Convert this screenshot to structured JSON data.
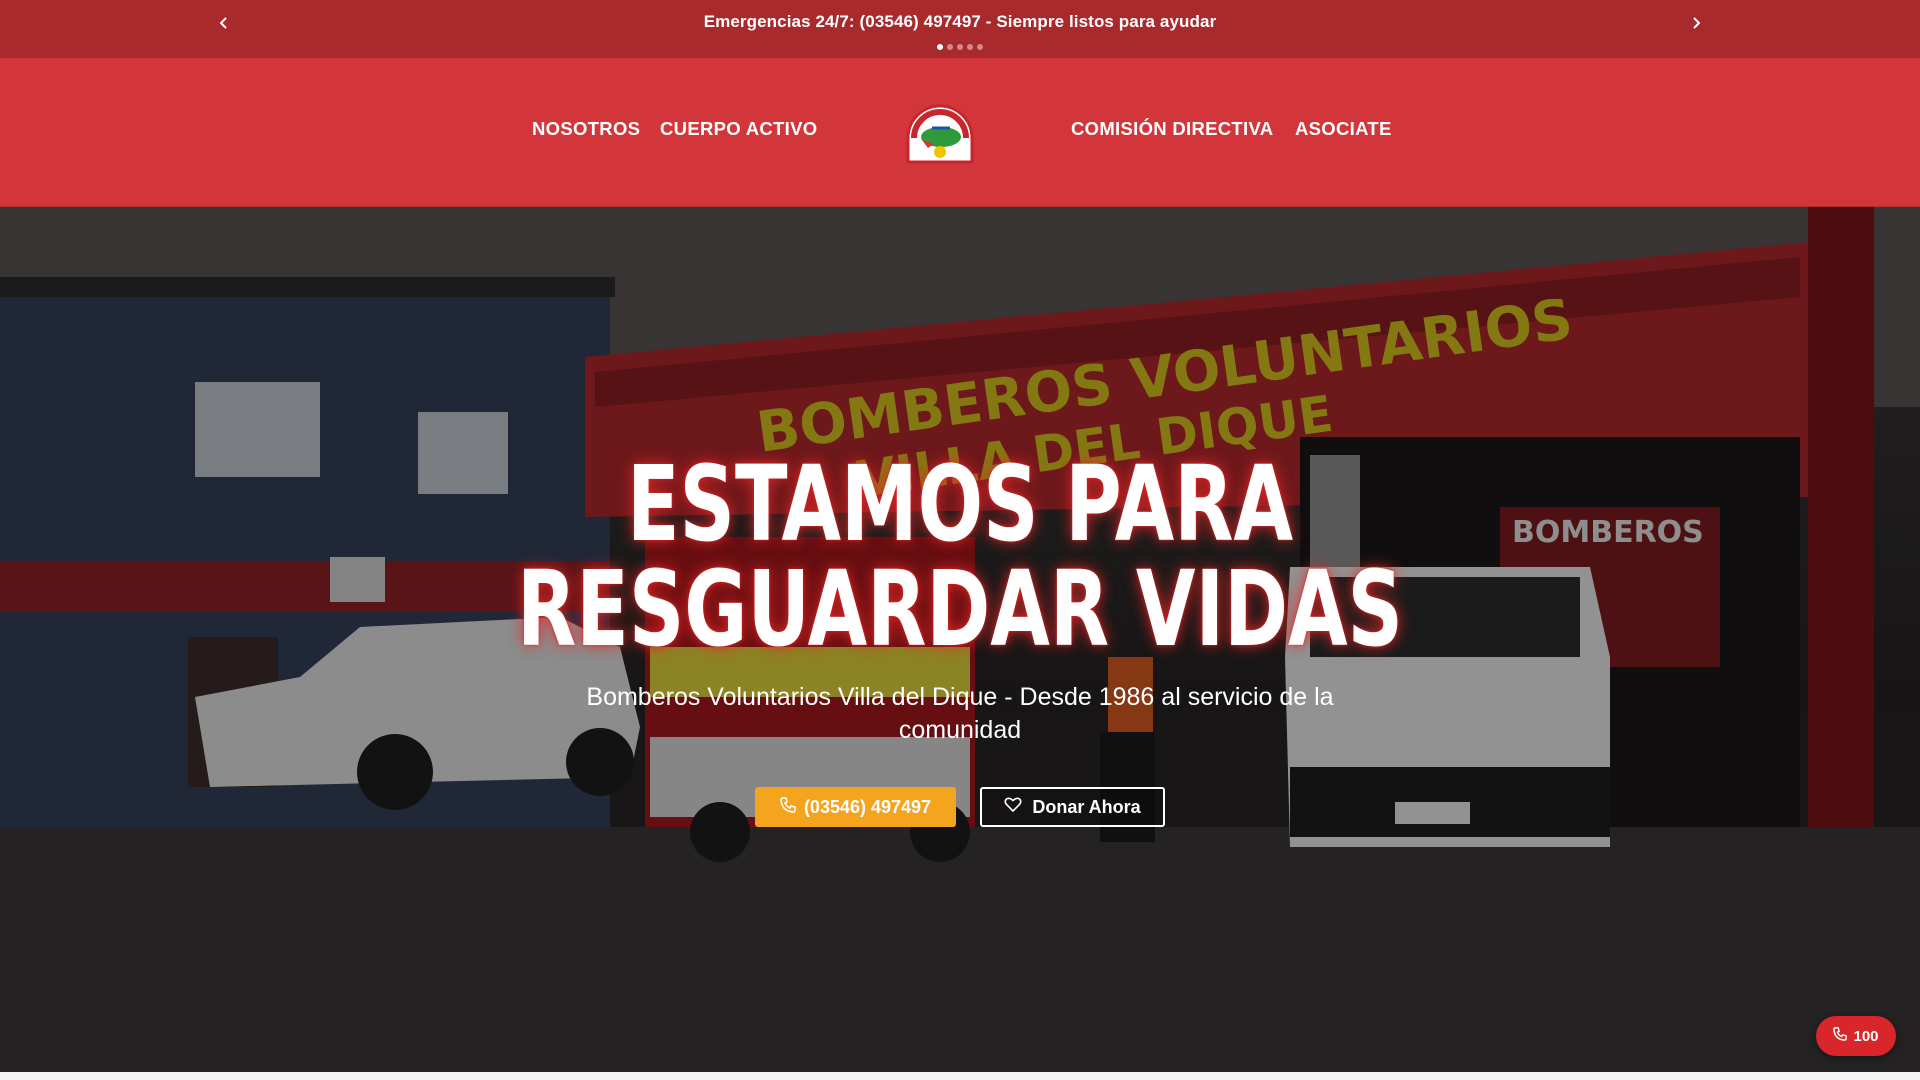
{
  "announcement": {
    "message": "Emergencias 24/7: (03546) 497497 - Siempre listos para ayudar",
    "prev_icon": "chevron-left-icon",
    "next_icon": "chevron-right-icon",
    "slides_total": 5,
    "slide_active": 1
  },
  "nav": {
    "left": [
      "NOSOTROS",
      "CUERPO ACTIVO"
    ],
    "right": [
      "COMISIÓN DIRECTIVA",
      "ASOCIATE"
    ],
    "logo_icon": "fire-department-logo"
  },
  "hero": {
    "title_line1": "ESTAMOS PARA",
    "title_line2": "RESGUARDAR VIDAS",
    "subtitle": "Bomberos Voluntarios Villa del Dique - Desde 1986 al servicio de la comunidad",
    "call_button": "(03546) 497497",
    "donate_button": "Donar Ahora",
    "call_icon": "phone-icon",
    "donate_icon": "heart-icon"
  },
  "floating": {
    "label": "100",
    "icon": "phone-icon"
  },
  "colors": {
    "topbar": "#a92a2d",
    "header": "#d2363a",
    "accent": "#f5a41d",
    "floating": "#d8262b"
  }
}
